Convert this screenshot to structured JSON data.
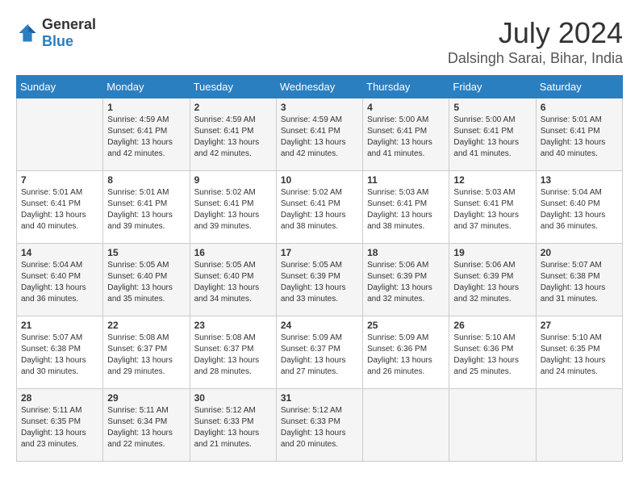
{
  "logo": {
    "general": "General",
    "blue": "Blue"
  },
  "title": "July 2024",
  "subtitle": "Dalsingh Sarai, Bihar, India",
  "weekdays": [
    "Sunday",
    "Monday",
    "Tuesday",
    "Wednesday",
    "Thursday",
    "Friday",
    "Saturday"
  ],
  "weeks": [
    [
      {
        "num": "",
        "sunrise": "",
        "sunset": "",
        "daylight": ""
      },
      {
        "num": "1",
        "sunrise": "4:59 AM",
        "sunset": "6:41 PM",
        "daylight": "13 hours and 42 minutes."
      },
      {
        "num": "2",
        "sunrise": "4:59 AM",
        "sunset": "6:41 PM",
        "daylight": "13 hours and 42 minutes."
      },
      {
        "num": "3",
        "sunrise": "4:59 AM",
        "sunset": "6:41 PM",
        "daylight": "13 hours and 42 minutes."
      },
      {
        "num": "4",
        "sunrise": "5:00 AM",
        "sunset": "6:41 PM",
        "daylight": "13 hours and 41 minutes."
      },
      {
        "num": "5",
        "sunrise": "5:00 AM",
        "sunset": "6:41 PM",
        "daylight": "13 hours and 41 minutes."
      },
      {
        "num": "6",
        "sunrise": "5:01 AM",
        "sunset": "6:41 PM",
        "daylight": "13 hours and 40 minutes."
      }
    ],
    [
      {
        "num": "7",
        "sunrise": "5:01 AM",
        "sunset": "6:41 PM",
        "daylight": "13 hours and 40 minutes."
      },
      {
        "num": "8",
        "sunrise": "5:01 AM",
        "sunset": "6:41 PM",
        "daylight": "13 hours and 39 minutes."
      },
      {
        "num": "9",
        "sunrise": "5:02 AM",
        "sunset": "6:41 PM",
        "daylight": "13 hours and 39 minutes."
      },
      {
        "num": "10",
        "sunrise": "5:02 AM",
        "sunset": "6:41 PM",
        "daylight": "13 hours and 38 minutes."
      },
      {
        "num": "11",
        "sunrise": "5:03 AM",
        "sunset": "6:41 PM",
        "daylight": "13 hours and 38 minutes."
      },
      {
        "num": "12",
        "sunrise": "5:03 AM",
        "sunset": "6:41 PM",
        "daylight": "13 hours and 37 minutes."
      },
      {
        "num": "13",
        "sunrise": "5:04 AM",
        "sunset": "6:40 PM",
        "daylight": "13 hours and 36 minutes."
      }
    ],
    [
      {
        "num": "14",
        "sunrise": "5:04 AM",
        "sunset": "6:40 PM",
        "daylight": "13 hours and 36 minutes."
      },
      {
        "num": "15",
        "sunrise": "5:05 AM",
        "sunset": "6:40 PM",
        "daylight": "13 hours and 35 minutes."
      },
      {
        "num": "16",
        "sunrise": "5:05 AM",
        "sunset": "6:40 PM",
        "daylight": "13 hours and 34 minutes."
      },
      {
        "num": "17",
        "sunrise": "5:05 AM",
        "sunset": "6:39 PM",
        "daylight": "13 hours and 33 minutes."
      },
      {
        "num": "18",
        "sunrise": "5:06 AM",
        "sunset": "6:39 PM",
        "daylight": "13 hours and 32 minutes."
      },
      {
        "num": "19",
        "sunrise": "5:06 AM",
        "sunset": "6:39 PM",
        "daylight": "13 hours and 32 minutes."
      },
      {
        "num": "20",
        "sunrise": "5:07 AM",
        "sunset": "6:38 PM",
        "daylight": "13 hours and 31 minutes."
      }
    ],
    [
      {
        "num": "21",
        "sunrise": "5:07 AM",
        "sunset": "6:38 PM",
        "daylight": "13 hours and 30 minutes."
      },
      {
        "num": "22",
        "sunrise": "5:08 AM",
        "sunset": "6:37 PM",
        "daylight": "13 hours and 29 minutes."
      },
      {
        "num": "23",
        "sunrise": "5:08 AM",
        "sunset": "6:37 PM",
        "daylight": "13 hours and 28 minutes."
      },
      {
        "num": "24",
        "sunrise": "5:09 AM",
        "sunset": "6:37 PM",
        "daylight": "13 hours and 27 minutes."
      },
      {
        "num": "25",
        "sunrise": "5:09 AM",
        "sunset": "6:36 PM",
        "daylight": "13 hours and 26 minutes."
      },
      {
        "num": "26",
        "sunrise": "5:10 AM",
        "sunset": "6:36 PM",
        "daylight": "13 hours and 25 minutes."
      },
      {
        "num": "27",
        "sunrise": "5:10 AM",
        "sunset": "6:35 PM",
        "daylight": "13 hours and 24 minutes."
      }
    ],
    [
      {
        "num": "28",
        "sunrise": "5:11 AM",
        "sunset": "6:35 PM",
        "daylight": "13 hours and 23 minutes."
      },
      {
        "num": "29",
        "sunrise": "5:11 AM",
        "sunset": "6:34 PM",
        "daylight": "13 hours and 22 minutes."
      },
      {
        "num": "30",
        "sunrise": "5:12 AM",
        "sunset": "6:33 PM",
        "daylight": "13 hours and 21 minutes."
      },
      {
        "num": "31",
        "sunrise": "5:12 AM",
        "sunset": "6:33 PM",
        "daylight": "13 hours and 20 minutes."
      },
      {
        "num": "",
        "sunrise": "",
        "sunset": "",
        "daylight": ""
      },
      {
        "num": "",
        "sunrise": "",
        "sunset": "",
        "daylight": ""
      },
      {
        "num": "",
        "sunrise": "",
        "sunset": "",
        "daylight": ""
      }
    ]
  ]
}
